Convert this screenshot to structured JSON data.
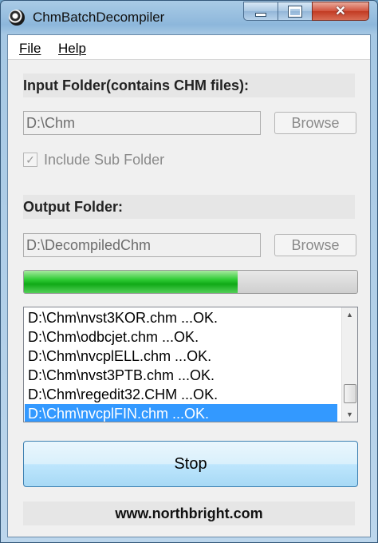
{
  "window": {
    "title": "ChmBatchDecompiler"
  },
  "menu": {
    "file": "File",
    "help": "Help"
  },
  "input": {
    "label": "Input Folder(contains CHM files):",
    "path": "D:\\Chm",
    "browse": "Browse",
    "include_sub": "Include Sub Folder",
    "include_sub_checked": true
  },
  "output": {
    "label": "Output Folder:",
    "path": "D:\\DecompiledChm",
    "browse": "Browse"
  },
  "progress": {
    "fraction": 0.64,
    "fill_color": "#10a917"
  },
  "log": {
    "items": [
      "D:\\Chm\\nvst3KOR.chm ...OK.",
      "D:\\Chm\\odbcjet.chm ...OK.",
      "D:\\Chm\\nvcplELL.chm ...OK.",
      "D:\\Chm\\nvst3PTB.chm ...OK.",
      "D:\\Chm\\regedit32.CHM ...OK.",
      "D:\\Chm\\nvcplFIN.chm ...OK."
    ],
    "selected_index": 5,
    "selection_color": "#3399ff"
  },
  "stop_button": "Stop",
  "footer": "www.northbright.com"
}
